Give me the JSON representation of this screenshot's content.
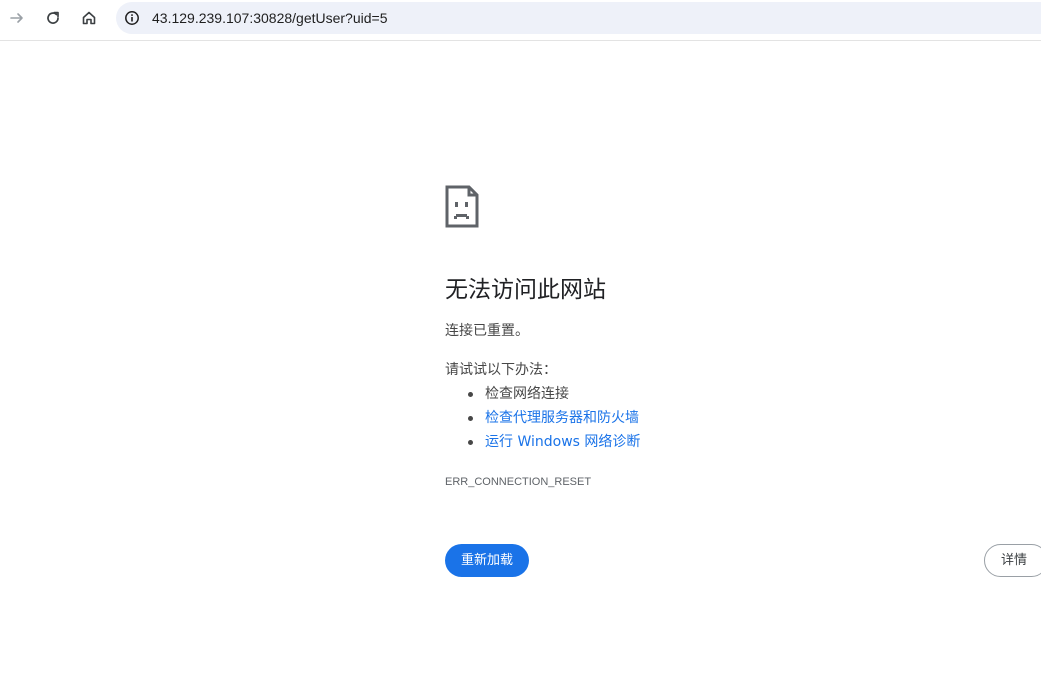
{
  "toolbar": {
    "back_icon": "arrow-forward-icon",
    "reload_icon": "reload-icon",
    "home_icon": "home-icon",
    "site_info_icon": "info-circle-icon",
    "url": "43.129.239.107:30828/getUser?uid=5"
  },
  "error_page": {
    "icon": "sad-page-icon",
    "title": "无法访问此网站",
    "description": "连接已重置。",
    "suggestions_heading": "请试试以下办法：",
    "suggestions": [
      {
        "label": "检查网络连接",
        "is_link": false
      },
      {
        "label": "检查代理服务器和防火墙",
        "is_link": true
      },
      {
        "label": "运行 Windows 网络诊断",
        "is_link": true
      }
    ],
    "error_code": "ERR_CONNECTION_RESET",
    "reload_button": "重新加载",
    "details_button": "详情"
  },
  "colors": {
    "link": "#1a73e8",
    "primary_button": "#1a73e8",
    "omnibox_bg": "#eef1f9"
  }
}
